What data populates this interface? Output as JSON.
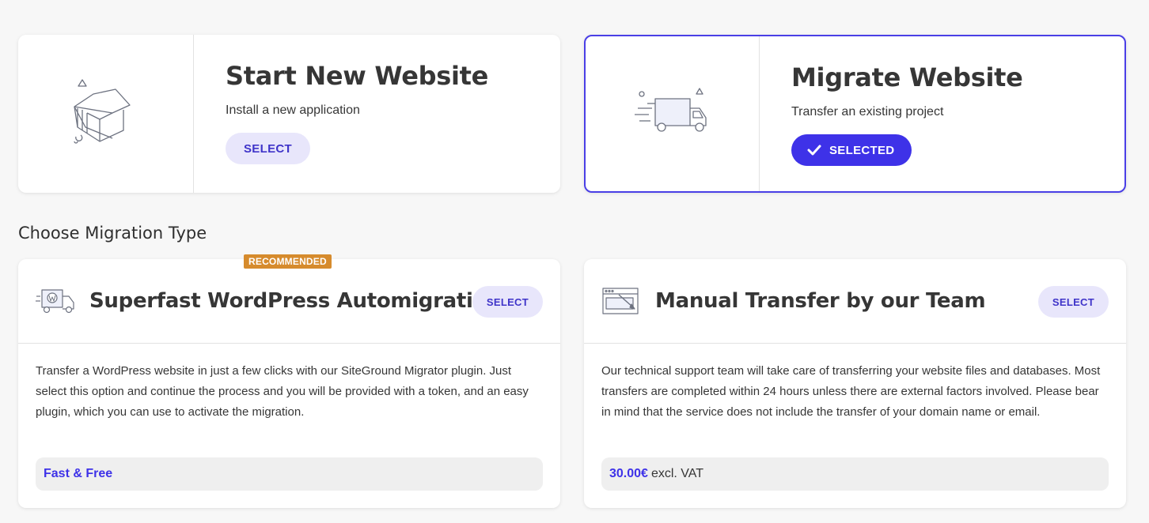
{
  "top_cards": {
    "start": {
      "title": "Start New Website",
      "subtitle": "Install a new application",
      "button": "SELECT",
      "icon": "house-box-icon"
    },
    "migrate": {
      "title": "Migrate Website",
      "subtitle": "Transfer an existing project",
      "button": "SELECTED",
      "icon": "delivery-truck-icon",
      "selected": true
    }
  },
  "section_title": "Choose Migration Type",
  "migration_types": {
    "auto": {
      "badge": "RECOMMENDED",
      "title": "Superfast WordPress Automigration",
      "button": "SELECT",
      "description": "Transfer a WordPress website in just a few clicks with our SiteGround Migrator plugin. Just select this option and continue the process and you will be provided with a token, and an easy plugin, which you can use to activate the migration.",
      "price_highlight": "Fast & Free",
      "price_rest": "",
      "icon": "wordpress-truck-icon"
    },
    "manual": {
      "title": "Manual Transfer by our Team",
      "button": "SELECT",
      "description": "Our technical support team will take care of transferring your website files and databases. Most transfers are completed within 24 hours unless there are external factors involved. Please bear in mind that the service does not include the transfer of your domain name or email.",
      "price_highlight": "30.00€",
      "price_rest": "excl. VAT",
      "icon": "browser-window-icon"
    }
  },
  "colors": {
    "accent": "#3e32e8",
    "accent_light": "#e8e6fb",
    "badge": "#d68b2d"
  }
}
